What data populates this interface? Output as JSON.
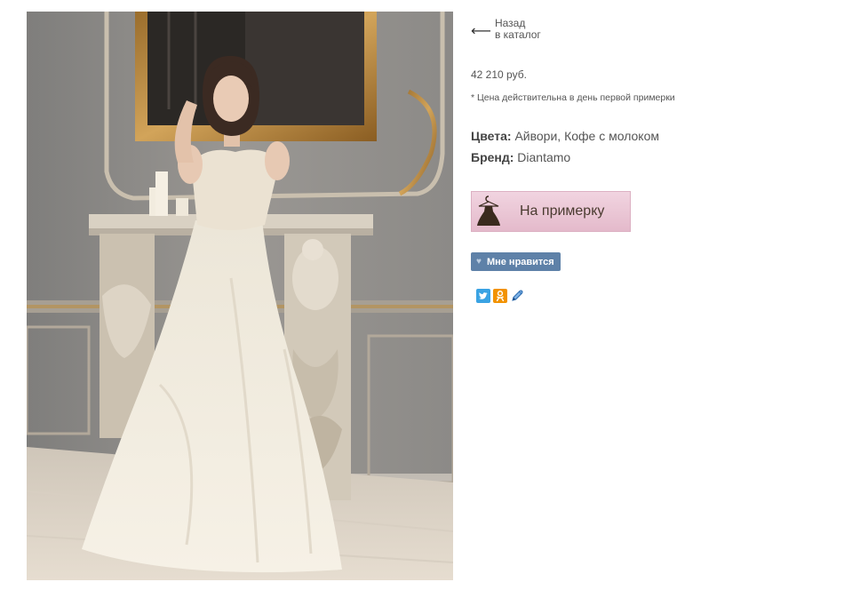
{
  "nav": {
    "back_arrow": "⟵",
    "back_line1": "Назад",
    "back_line2": "в каталог"
  },
  "product": {
    "price": "42 210 руб.",
    "price_note": "* Цена действительна в день первой примерки",
    "colors_label": "Цвета:",
    "colors_value": "Айвори, Кофе с молоком",
    "brand_label": "Бренд:",
    "brand_value": "Diantamo"
  },
  "actions": {
    "fitting_label": "На примерку",
    "like_label": "Мне нравится",
    "like_icon": "♥"
  },
  "social": {
    "icons": [
      "twitter-icon",
      "odnoklassniki-icon",
      "livejournal-icon"
    ]
  },
  "colors": {
    "fitting_bg": "#e8c3d2",
    "like_bg": "#5e81a8",
    "twitter": "#3aa3e3",
    "odnoklassniki": "#f29200",
    "livejournal": "#2b6cb0"
  }
}
